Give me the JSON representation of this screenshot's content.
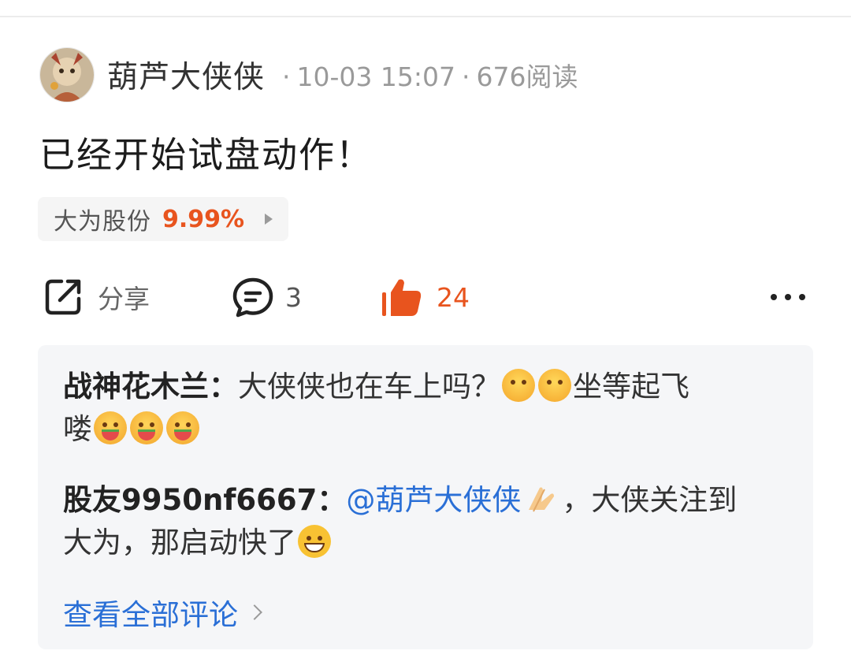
{
  "post": {
    "author": "葫芦大侠侠",
    "date": "10-03 15:07",
    "read_count": "676阅读",
    "separator": "·",
    "text": "已经开始试盘动作！",
    "stock": {
      "name": "大为股份",
      "change": "9.99%"
    }
  },
  "actions": {
    "share_label": "分享",
    "comment_count": "3",
    "like_count": "24"
  },
  "comments": [
    {
      "user": "战神花木兰：",
      "text_a": "大侠侠也在车上吗？",
      "text_b": "坐等起飞",
      "text_c": "喽"
    },
    {
      "user": "股友9950nf6667：",
      "mention": "@葫芦大侠侠",
      "text_a": "，大侠关注到",
      "text_b": "大为，那启动快了"
    }
  ],
  "view_all_label": "查看全部评论",
  "colors": {
    "accent": "#e8541e",
    "link": "#2a6fd6"
  },
  "icons": [
    "share-icon",
    "comment-icon",
    "thumbs-up-icon",
    "more-icon",
    "shy-face-emoji",
    "watermelon-face-emoji",
    "pray-hands-emoji",
    "grin-face-emoji",
    "chevron-right-icon"
  ]
}
